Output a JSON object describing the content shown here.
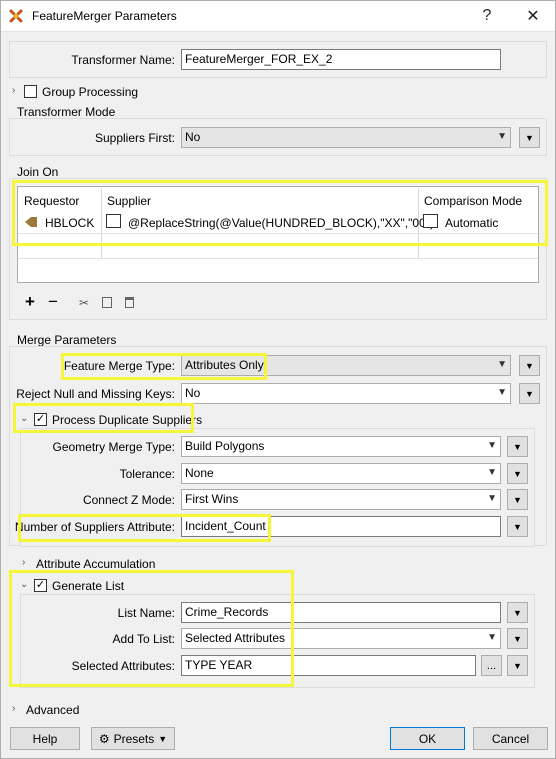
{
  "window": {
    "title": "FeatureMerger Parameters"
  },
  "transformer_name": {
    "label": "Transformer Name:",
    "value": "FeatureMerger_FOR_EX_2"
  },
  "group_processing": {
    "label": "Group Processing"
  },
  "transformer_mode": {
    "section": "Transformer Mode",
    "suppliers_first_label": "Suppliers First:",
    "suppliers_first_value": "No"
  },
  "join_on": {
    "section": "Join On",
    "columns": [
      "Requestor",
      "Supplier",
      "Comparison Mode"
    ],
    "row": {
      "requestor": "HBLOCK",
      "supplier": "@ReplaceString(@Value(HUNDRED_BLOCK),\"XX\",\"00\")",
      "comparison": "Automatic"
    },
    "toolbar": {
      "add": "+",
      "remove": "−"
    }
  },
  "merge_parameters": {
    "section": "Merge Parameters",
    "feature_merge_type_label": "Feature Merge Type:",
    "feature_merge_type_value": "Attributes Only",
    "reject_null_label": "Reject Null and Missing Keys:",
    "reject_null_value": "No",
    "process_duplicate_label": "Process Duplicate Suppliers",
    "geometry_merge_type_label": "Geometry Merge Type:",
    "geometry_merge_type_value": "Build Polygons",
    "tolerance_label": "Tolerance:",
    "tolerance_value": "None",
    "connect_z_label": "Connect Z Mode:",
    "connect_z_value": "First Wins",
    "num_suppliers_label": "Number of Suppliers Attribute:",
    "num_suppliers_value": "Incident_Count"
  },
  "attribute_accumulation": {
    "label": "Attribute Accumulation"
  },
  "generate_list": {
    "label": "Generate List",
    "list_name_label": "List Name:",
    "list_name_value": "Crime_Records",
    "add_to_list_label": "Add To List:",
    "add_to_list_value": "Selected Attributes",
    "selected_attributes_label": "Selected Attributes:",
    "selected_attributes_value": "TYPE YEAR",
    "ellipsis": "..."
  },
  "advanced": {
    "label": "Advanced"
  },
  "footer": {
    "help": "Help",
    "presets": "Presets",
    "ok": "OK",
    "cancel": "Cancel"
  }
}
